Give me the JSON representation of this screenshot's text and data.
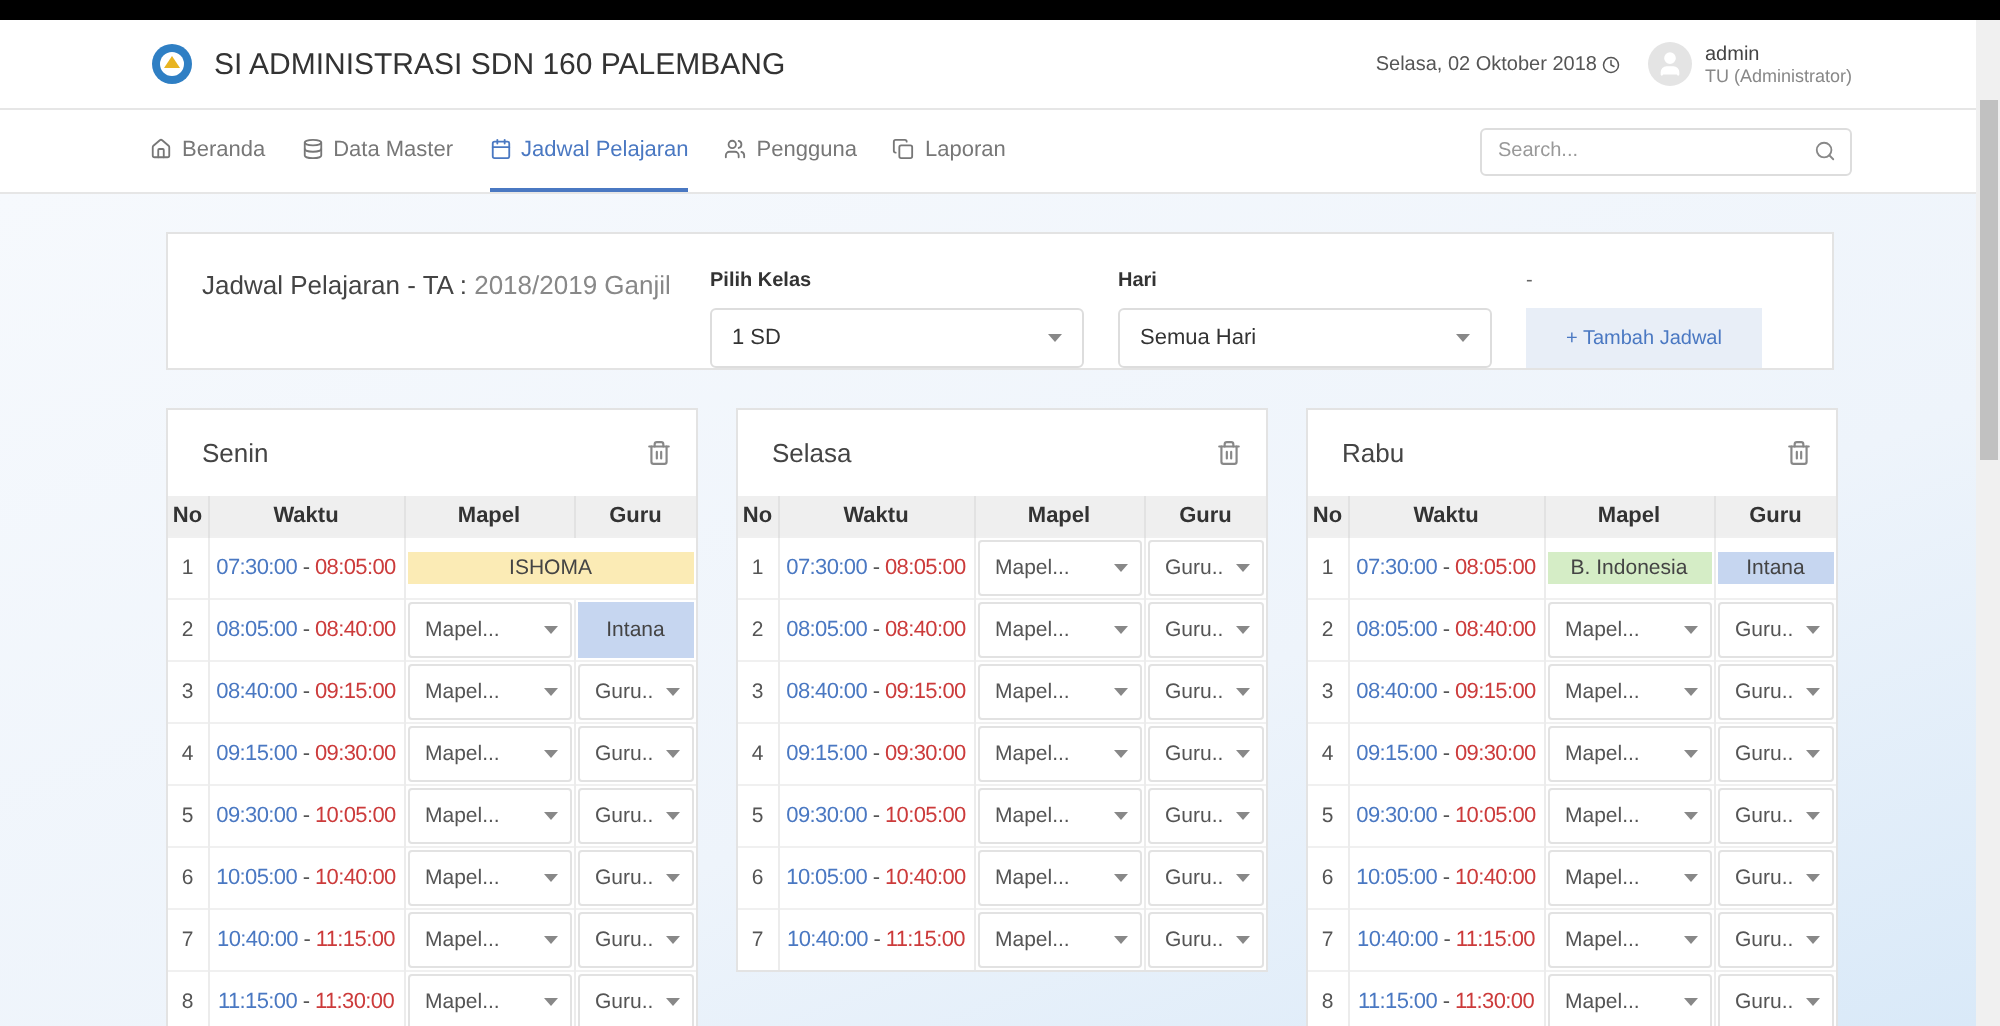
{
  "app": {
    "title": "SI ADMINISTRASI SDN 160 PALEMBANG",
    "date": "Selasa, 02 Oktober 2018",
    "user": {
      "name": "admin",
      "role": "TU (Administrator)"
    }
  },
  "nav": [
    {
      "label": "Beranda",
      "selected": false
    },
    {
      "label": "Data Master",
      "selected": false
    },
    {
      "label": "Jadwal Pelajaran",
      "selected": true
    },
    {
      "label": "Pengguna",
      "selected": false
    },
    {
      "label": "Laporan",
      "selected": false
    }
  ],
  "search": {
    "placeholder": "Search..."
  },
  "filter": {
    "title": "Jadwal Pelajaran - TA : ",
    "period": "2018/2019 Ganjil",
    "class_label": "Pilih Kelas",
    "class_value": "1 SD",
    "day_label": "Hari",
    "day_value": "Semua Hari",
    "action_label": "-",
    "action_button": "+ Tambah Jadwal"
  },
  "days": [
    {
      "name": "Senin",
      "columns": [
        "No",
        "Waktu",
        "Mapel",
        "Guru"
      ],
      "rows": [
        {
          "cells": [
            {
              "kind": "number",
              "text": "1"
            },
            {
              "kind": "time",
              "start": "07:30:00",
              "sep": "-",
              "end": "08:05:00"
            },
            {
              "kind": "span",
              "colspan": 2,
              "text": "ISHOMA",
              "color": "#fbebb5"
            }
          ]
        },
        {
          "cells": [
            {
              "kind": "number",
              "text": "2"
            },
            {
              "kind": "time",
              "start": "08:05:00",
              "sep": "-",
              "end": "08:40:00"
            },
            {
              "kind": "select",
              "text": "Mapel..."
            },
            {
              "kind": "filled",
              "text": "Intana",
              "color": "#c6d6f0"
            }
          ]
        },
        {
          "cells": [
            {
              "kind": "number",
              "text": "3"
            },
            {
              "kind": "time",
              "start": "08:40:00",
              "sep": "-",
              "end": "09:15:00"
            },
            {
              "kind": "select",
              "text": "Mapel..."
            },
            {
              "kind": "select",
              "text": "Guru.."
            }
          ]
        },
        {
          "cells": [
            {
              "kind": "number",
              "text": "4"
            },
            {
              "kind": "time",
              "start": "09:15:00",
              "sep": "-",
              "end": "09:30:00"
            },
            {
              "kind": "select",
              "text": "Mapel..."
            },
            {
              "kind": "select",
              "text": "Guru.."
            }
          ]
        },
        {
          "cells": [
            {
              "kind": "number",
              "text": "5"
            },
            {
              "kind": "time",
              "start": "09:30:00",
              "sep": "-",
              "end": "10:05:00"
            },
            {
              "kind": "select",
              "text": "Mapel..."
            },
            {
              "kind": "select",
              "text": "Guru.."
            }
          ]
        },
        {
          "cells": [
            {
              "kind": "number",
              "text": "6"
            },
            {
              "kind": "time",
              "start": "10:05:00",
              "sep": "-",
              "end": "10:40:00"
            },
            {
              "kind": "select",
              "text": "Mapel..."
            },
            {
              "kind": "select",
              "text": "Guru.."
            }
          ]
        },
        {
          "cells": [
            {
              "kind": "number",
              "text": "7"
            },
            {
              "kind": "time",
              "start": "10:40:00",
              "sep": "-",
              "end": "11:15:00"
            },
            {
              "kind": "select",
              "text": "Mapel..."
            },
            {
              "kind": "select",
              "text": "Guru.."
            }
          ]
        },
        {
          "cells": [
            {
              "kind": "number",
              "text": "8"
            },
            {
              "kind": "time",
              "start": "11:15:00",
              "sep": "-",
              "end": "11:30:00"
            },
            {
              "kind": "select",
              "text": "Mapel..."
            },
            {
              "kind": "select",
              "text": "Guru.."
            }
          ]
        }
      ]
    },
    {
      "name": "Selasa",
      "columns": [
        "No",
        "Waktu",
        "Mapel",
        "Guru"
      ],
      "rows": [
        {
          "cells": [
            {
              "kind": "number",
              "text": "1"
            },
            {
              "kind": "time",
              "start": "07:30:00",
              "sep": "-",
              "end": "08:05:00"
            },
            {
              "kind": "select",
              "text": "Mapel..."
            },
            {
              "kind": "select",
              "text": "Guru.."
            }
          ]
        },
        {
          "cells": [
            {
              "kind": "number",
              "text": "2"
            },
            {
              "kind": "time",
              "start": "08:05:00",
              "sep": "-",
              "end": "08:40:00"
            },
            {
              "kind": "select",
              "text": "Mapel..."
            },
            {
              "kind": "select",
              "text": "Guru.."
            }
          ]
        },
        {
          "cells": [
            {
              "kind": "number",
              "text": "3"
            },
            {
              "kind": "time",
              "start": "08:40:00",
              "sep": "-",
              "end": "09:15:00"
            },
            {
              "kind": "select",
              "text": "Mapel..."
            },
            {
              "kind": "select",
              "text": "Guru.."
            }
          ]
        },
        {
          "cells": [
            {
              "kind": "number",
              "text": "4"
            },
            {
              "kind": "time",
              "start": "09:15:00",
              "sep": "-",
              "end": "09:30:00"
            },
            {
              "kind": "select",
              "text": "Mapel..."
            },
            {
              "kind": "select",
              "text": "Guru.."
            }
          ]
        },
        {
          "cells": [
            {
              "kind": "number",
              "text": "5"
            },
            {
              "kind": "time",
              "start": "09:30:00",
              "sep": "-",
              "end": "10:05:00"
            },
            {
              "kind": "select",
              "text": "Mapel..."
            },
            {
              "kind": "select",
              "text": "Guru.."
            }
          ]
        },
        {
          "cells": [
            {
              "kind": "number",
              "text": "6"
            },
            {
              "kind": "time",
              "start": "10:05:00",
              "sep": "-",
              "end": "10:40:00"
            },
            {
              "kind": "select",
              "text": "Mapel..."
            },
            {
              "kind": "select",
              "text": "Guru.."
            }
          ]
        },
        {
          "cells": [
            {
              "kind": "number",
              "text": "7"
            },
            {
              "kind": "time",
              "start": "10:40:00",
              "sep": "-",
              "end": "11:15:00"
            },
            {
              "kind": "select",
              "text": "Mapel..."
            },
            {
              "kind": "select",
              "text": "Guru.."
            }
          ]
        }
      ]
    },
    {
      "name": "Rabu",
      "columns": [
        "No",
        "Waktu",
        "Mapel",
        "Guru"
      ],
      "rows": [
        {
          "cells": [
            {
              "kind": "number",
              "text": "1"
            },
            {
              "kind": "time",
              "start": "07:30:00",
              "sep": "-",
              "end": "08:05:00"
            },
            {
              "kind": "filled",
              "text": "B. Indonesia",
              "color": "#d5edc6"
            },
            {
              "kind": "filled",
              "text": "Intana",
              "color": "#c6d6f0"
            }
          ]
        },
        {
          "cells": [
            {
              "kind": "number",
              "text": "2"
            },
            {
              "kind": "time",
              "start": "08:05:00",
              "sep": "-",
              "end": "08:40:00"
            },
            {
              "kind": "select",
              "text": "Mapel..."
            },
            {
              "kind": "select",
              "text": "Guru.."
            }
          ]
        },
        {
          "cells": [
            {
              "kind": "number",
              "text": "3"
            },
            {
              "kind": "time",
              "start": "08:40:00",
              "sep": "-",
              "end": "09:15:00"
            },
            {
              "kind": "select",
              "text": "Mapel..."
            },
            {
              "kind": "select",
              "text": "Guru.."
            }
          ]
        },
        {
          "cells": [
            {
              "kind": "number",
              "text": "4"
            },
            {
              "kind": "time",
              "start": "09:15:00",
              "sep": "-",
              "end": "09:30:00"
            },
            {
              "kind": "select",
              "text": "Mapel..."
            },
            {
              "kind": "select",
              "text": "Guru.."
            }
          ]
        },
        {
          "cells": [
            {
              "kind": "number",
              "text": "5"
            },
            {
              "kind": "time",
              "start": "09:30:00",
              "sep": "-",
              "end": "10:05:00"
            },
            {
              "kind": "select",
              "text": "Mapel..."
            },
            {
              "kind": "select",
              "text": "Guru.."
            }
          ]
        },
        {
          "cells": [
            {
              "kind": "number",
              "text": "6"
            },
            {
              "kind": "time",
              "start": "10:05:00",
              "sep": "-",
              "end": "10:40:00"
            },
            {
              "kind": "select",
              "text": "Mapel..."
            },
            {
              "kind": "select",
              "text": "Guru.."
            }
          ]
        },
        {
          "cells": [
            {
              "kind": "number",
              "text": "7"
            },
            {
              "kind": "time",
              "start": "10:40:00",
              "sep": "-",
              "end": "11:15:00"
            },
            {
              "kind": "select",
              "text": "Mapel..."
            },
            {
              "kind": "select",
              "text": "Guru.."
            }
          ]
        },
        {
          "cells": [
            {
              "kind": "number",
              "text": "8"
            },
            {
              "kind": "time",
              "start": "11:15:00",
              "sep": "-",
              "end": "11:30:00"
            },
            {
              "kind": "select",
              "text": "Mapel..."
            },
            {
              "kind": "select",
              "text": "Guru.."
            }
          ]
        }
      ]
    }
  ]
}
